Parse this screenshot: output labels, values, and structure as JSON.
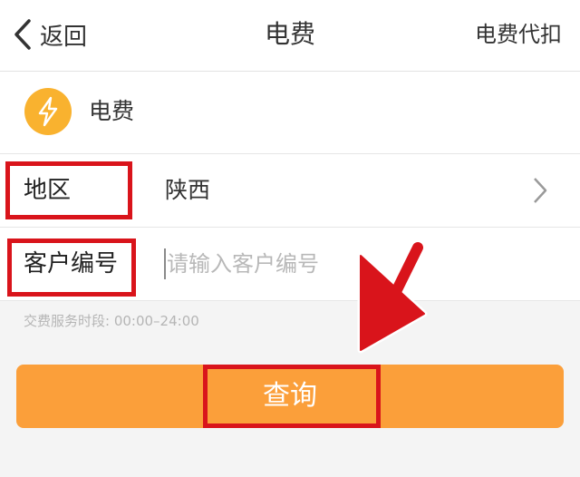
{
  "nav": {
    "back_label": "返回",
    "title": "电费",
    "right_action": "电费代扣"
  },
  "service": {
    "icon": "lightning-icon",
    "label": "电费",
    "icon_color": "#f9b22f"
  },
  "form": {
    "region": {
      "label": "地区",
      "value": "陕西"
    },
    "customer_number": {
      "label": "客户编号",
      "value": "",
      "placeholder": "请输入客户编号"
    }
  },
  "service_hours": "交费服务时段: 00:00–24:00",
  "query_button": {
    "label": "查询",
    "color": "#fb9f3a"
  },
  "annotation_color": "#d9141b"
}
